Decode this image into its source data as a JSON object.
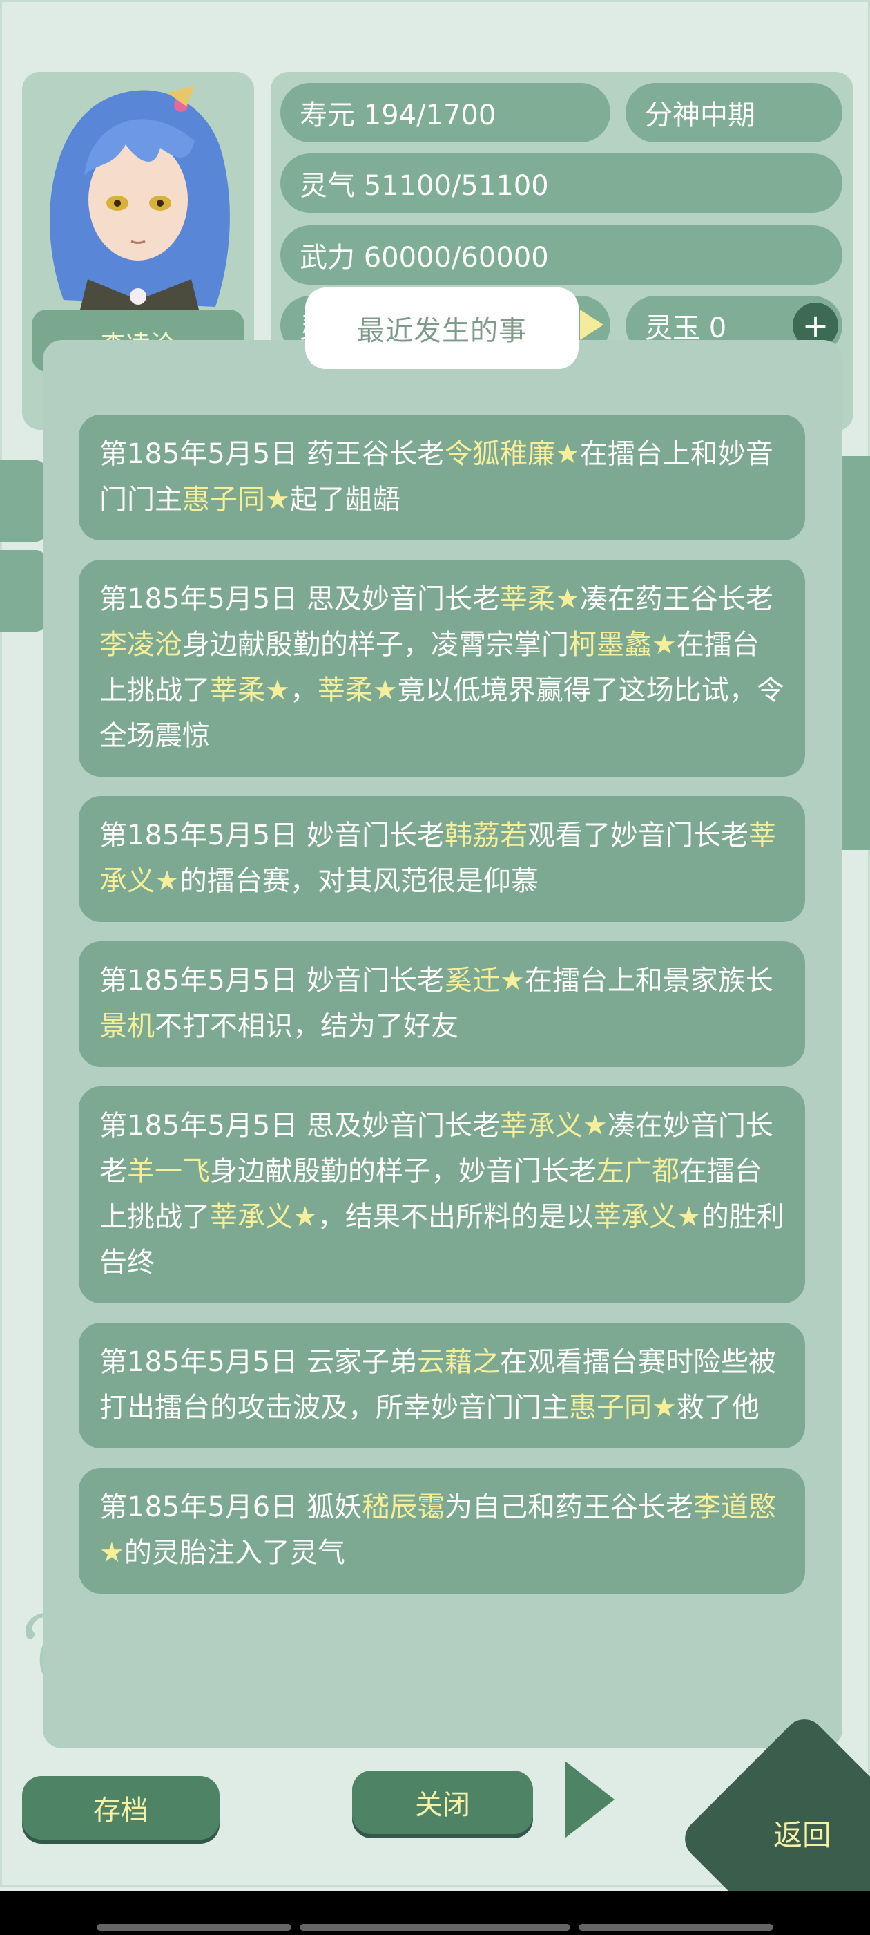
{
  "character": {
    "name_partial": "李凌沧"
  },
  "stats": {
    "lifespan": "寿元 194/1700",
    "realm": "分神中期",
    "qi": "灵气 51100/51100",
    "force": "武力 60000/60000",
    "stone_partial": "灵",
    "jade": "灵玉 0",
    "plus": "+"
  },
  "modal": {
    "title": "最近发生的事",
    "events": [
      {
        "parts": [
          {
            "t": "第185年5月5日 药王谷长老"
          },
          {
            "t": "令狐稚廉",
            "hl": true
          },
          {
            "t": "★",
            "star": true
          },
          {
            "t": "在擂台上和妙音门门主"
          },
          {
            "t": "惠子同",
            "hl": true
          },
          {
            "t": "★",
            "star": true
          },
          {
            "t": "起了龃龉"
          }
        ]
      },
      {
        "parts": [
          {
            "t": "第185年5月5日 思及妙音门长老"
          },
          {
            "t": "莘柔",
            "hl": true
          },
          {
            "t": "★",
            "star": true
          },
          {
            "t": "凑在药王谷长老"
          },
          {
            "t": "李凌沧",
            "hl": true
          },
          {
            "t": "身边献殷勤的样子，凌霄宗掌门"
          },
          {
            "t": "柯墨蠡",
            "hl": true
          },
          {
            "t": "★",
            "star": true
          },
          {
            "t": "在擂台上挑战了"
          },
          {
            "t": "莘柔",
            "hl": true
          },
          {
            "t": "★",
            "star": true
          },
          {
            "t": "，"
          },
          {
            "t": "莘柔",
            "hl": true
          },
          {
            "t": "★",
            "star": true
          },
          {
            "t": "竟以低境界赢得了这场比试，令全场震惊"
          }
        ]
      },
      {
        "parts": [
          {
            "t": "第185年5月5日 妙音门长老"
          },
          {
            "t": "韩荔若",
            "hl": true
          },
          {
            "t": "观看了妙音门长老"
          },
          {
            "t": "莘承义",
            "hl": true
          },
          {
            "t": "★",
            "star": true
          },
          {
            "t": "的擂台赛，对其风范很是仰慕"
          }
        ]
      },
      {
        "parts": [
          {
            "t": "第185年5月5日 妙音门长老"
          },
          {
            "t": "奚迁",
            "hl": true
          },
          {
            "t": "★",
            "star": true
          },
          {
            "t": "在擂台上和景家族长"
          },
          {
            "t": "景机",
            "hl": true
          },
          {
            "t": "不打不相识，结为了好友"
          }
        ]
      },
      {
        "parts": [
          {
            "t": "第185年5月5日 思及妙音门长老"
          },
          {
            "t": "莘承义",
            "hl": true
          },
          {
            "t": "★",
            "star": true
          },
          {
            "t": "凑在妙音门长老"
          },
          {
            "t": "羊一飞",
            "hl": true
          },
          {
            "t": "身边献殷勤的样子，妙音门长老"
          },
          {
            "t": "左广都",
            "hl": true
          },
          {
            "t": "在擂台上挑战了"
          },
          {
            "t": "莘承义",
            "hl": true
          },
          {
            "t": "★",
            "star": true
          },
          {
            "t": "，结果不出所料的是以"
          },
          {
            "t": "莘承义",
            "hl": true
          },
          {
            "t": "★",
            "star": true
          },
          {
            "t": "的胜利告终"
          }
        ]
      },
      {
        "parts": [
          {
            "t": "第185年5月5日 云家子弟"
          },
          {
            "t": "云藉之",
            "hl": true
          },
          {
            "t": "在观看擂台赛时险些被打出擂台的攻击波及，所幸妙音门门主"
          },
          {
            "t": "惠子同",
            "hl": true
          },
          {
            "t": "★",
            "star": true
          },
          {
            "t": "救了他"
          }
        ]
      },
      {
        "parts": [
          {
            "t": "第185年5月6日 狐妖"
          },
          {
            "t": "嵇辰霭",
            "hl": true
          },
          {
            "t": "为自己和药王谷长老"
          },
          {
            "t": "李道愍",
            "hl": true
          },
          {
            "t": "★",
            "star": true
          },
          {
            "t": "的灵胎注入了灵气"
          }
        ]
      }
    ]
  },
  "bottom": {
    "save": "存档",
    "close": "关闭",
    "back": "返回"
  },
  "colors": {
    "highlight": "#f5ef9c",
    "card": "#7da891",
    "modal": "#b3cfc1"
  }
}
